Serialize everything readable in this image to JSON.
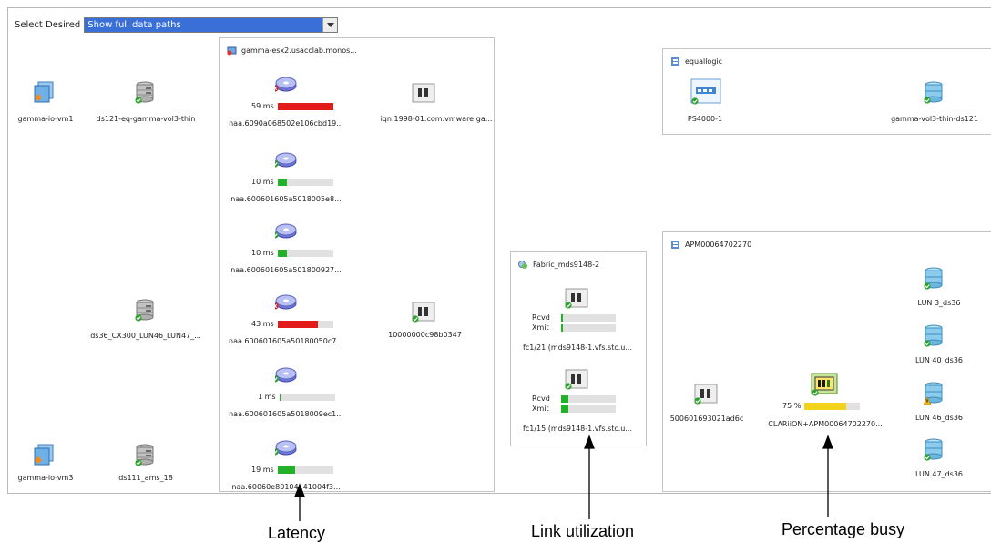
{
  "toolbar": {
    "select_label": "Select Desired",
    "select_value": "Show full data paths"
  },
  "panels": {
    "esx": {
      "title": "gamma-esx2.usacclab.monos..."
    },
    "equallogic": {
      "title": "equallogic"
    },
    "fabric": {
      "title": "Fabric_mds9148-2"
    },
    "apm": {
      "title": "APM00064702270"
    }
  },
  "vms": [
    {
      "label": "gamma-io-vm1"
    },
    {
      "label": "gamma-io-vm3"
    }
  ],
  "datastores": [
    {
      "label": "ds121-eq-gamma-vol3-thin"
    },
    {
      "label": "ds36_CX300_LUN46_LUN47_..."
    },
    {
      "label": "ds111_ams_18"
    }
  ],
  "disks": [
    {
      "latency": "59 ms",
      "latency_ms": 59,
      "status": "error",
      "label": "naa.6090a068502e106cbd19..."
    },
    {
      "latency": "10 ms",
      "latency_ms": 10,
      "status": "ok",
      "label": "naa.600601605a5018005e8..."
    },
    {
      "latency": "10 ms",
      "latency_ms": 10,
      "status": "ok",
      "label": "naa.600601605a501800927..."
    },
    {
      "latency": "43 ms",
      "latency_ms": 43,
      "status": "error",
      "label": "naa.600601605a50180050c7..."
    },
    {
      "latency": "1 ms",
      "latency_ms": 1,
      "status": "ok",
      "label": "naa.600601605a5018009ec1..."
    },
    {
      "latency": "19 ms",
      "latency_ms": 19,
      "status": "ok",
      "label": "naa.60060e80104..41004f3..."
    }
  ],
  "hbas": [
    {
      "label": "iqn.1998-01.com.vmware:ga..."
    },
    {
      "label": "10000000c98b0347"
    }
  ],
  "fabric_ports": [
    {
      "label": "fc1/21 (mds9148-1.vfs.stc.u...",
      "rcvd": "Rcvd",
      "xmit": "Xmit",
      "rcvd_util": 0.03,
      "xmit_util": 0.03
    },
    {
      "label": "fc1/15 (mds9148-1.vfs.stc.u...",
      "rcvd": "Rcvd",
      "xmit": "Xmit",
      "rcvd_util": 0.14,
      "xmit_util": 0.14
    }
  ],
  "equallogic": {
    "array": "PS4000-1",
    "volume": "gamma-vol3-thin-ds121"
  },
  "apm": {
    "port": "500601693021ad6c",
    "array": "CLARiiON+APM00064702270...",
    "busy": "75 %",
    "busy_fraction": 0.75,
    "luns": [
      {
        "label": "LUN 3_ds36",
        "status": "ok"
      },
      {
        "label": "LUN 40_ds36",
        "status": "ok"
      },
      {
        "label": "LUN 46_ds36",
        "status": "warning"
      },
      {
        "label": "LUN 47_ds36",
        "status": "ok"
      }
    ]
  },
  "annotations": {
    "latency": "Latency",
    "link": "Link utilization",
    "busy": "Percentage busy"
  },
  "colors": {
    "error": "#e41b1b",
    "ok": "#22b22a",
    "busy": "#f2d21a",
    "track": "#e1e1e1",
    "select": "#3a6fd8"
  }
}
